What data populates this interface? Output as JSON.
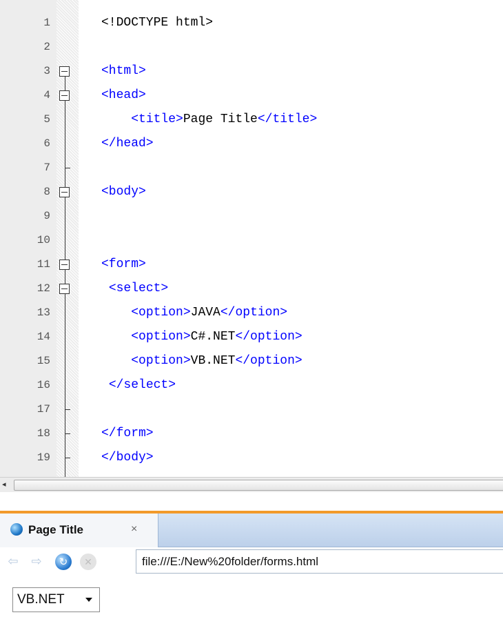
{
  "editor": {
    "lines": [
      {
        "n": "1",
        "segs": [
          {
            "c": "txt",
            "t": "<!DOCTYPE html>"
          }
        ]
      },
      {
        "n": "2",
        "segs": []
      },
      {
        "n": "3",
        "segs": [
          {
            "c": "tag",
            "t": "<html>"
          }
        ]
      },
      {
        "n": "4",
        "segs": [
          {
            "c": "tag",
            "t": "<head>"
          }
        ]
      },
      {
        "n": "5",
        "segs": [
          {
            "c": "txt",
            "t": "    "
          },
          {
            "c": "tag",
            "t": "<title>"
          },
          {
            "c": "txt",
            "t": "Page Title"
          },
          {
            "c": "tag",
            "t": "</title>"
          }
        ]
      },
      {
        "n": "6",
        "segs": [
          {
            "c": "tag",
            "t": "</head>"
          }
        ]
      },
      {
        "n": "7",
        "segs": []
      },
      {
        "n": "8",
        "segs": [
          {
            "c": "tag",
            "t": "<body>"
          }
        ]
      },
      {
        "n": "9",
        "segs": []
      },
      {
        "n": "10",
        "segs": []
      },
      {
        "n": "11",
        "segs": [
          {
            "c": "tag",
            "t": "<form>"
          }
        ]
      },
      {
        "n": "12",
        "segs": [
          {
            "c": "txt",
            "t": " "
          },
          {
            "c": "tag",
            "t": "<select>"
          }
        ]
      },
      {
        "n": "13",
        "segs": [
          {
            "c": "txt",
            "t": "    "
          },
          {
            "c": "tag",
            "t": "<option>"
          },
          {
            "c": "txt",
            "t": "JAVA"
          },
          {
            "c": "tag",
            "t": "</option>"
          }
        ]
      },
      {
        "n": "14",
        "segs": [
          {
            "c": "txt",
            "t": "    "
          },
          {
            "c": "tag",
            "t": "<option>"
          },
          {
            "c": "txt",
            "t": "C#.NET"
          },
          {
            "c": "tag",
            "t": "</option>"
          }
        ]
      },
      {
        "n": "15",
        "segs": [
          {
            "c": "txt",
            "t": "    "
          },
          {
            "c": "tag",
            "t": "<option>"
          },
          {
            "c": "txt",
            "t": "VB.NET"
          },
          {
            "c": "tag",
            "t": "</option>"
          }
        ]
      },
      {
        "n": "16",
        "segs": [
          {
            "c": "txt",
            "t": " "
          },
          {
            "c": "tag",
            "t": "</select>"
          }
        ]
      },
      {
        "n": "17",
        "segs": []
      },
      {
        "n": "18",
        "segs": [
          {
            "c": "tag",
            "t": "</form>"
          }
        ]
      },
      {
        "n": "19",
        "segs": [
          {
            "c": "tag",
            "t": "</body>"
          }
        ]
      }
    ],
    "fold_open_lines": [
      "3",
      "4",
      "8",
      "11",
      "12"
    ],
    "fold_end_lines": [
      "7",
      "17",
      "18",
      "19"
    ],
    "colors": {
      "tag": "#0000ff",
      "text": "#000000",
      "line_number": "#555555"
    }
  },
  "scrollbar": {
    "left_arrow_icon": "arrow-left-icon"
  },
  "browser": {
    "tab": {
      "title": "Page Title",
      "close_label": "×",
      "icon": "browser-globe-icon"
    },
    "nav": {
      "back_icon": "back-arrow-icon",
      "forward_icon": "forward-arrow-icon",
      "reload_icon": "reload-icon",
      "stop_icon": "stop-icon"
    },
    "url": "file:///E:/New%20folder/forms.html",
    "select": {
      "value": "VB.NET",
      "options": [
        "JAVA",
        "C#.NET",
        "VB.NET"
      ]
    },
    "accent_color": "#f29a2b"
  }
}
